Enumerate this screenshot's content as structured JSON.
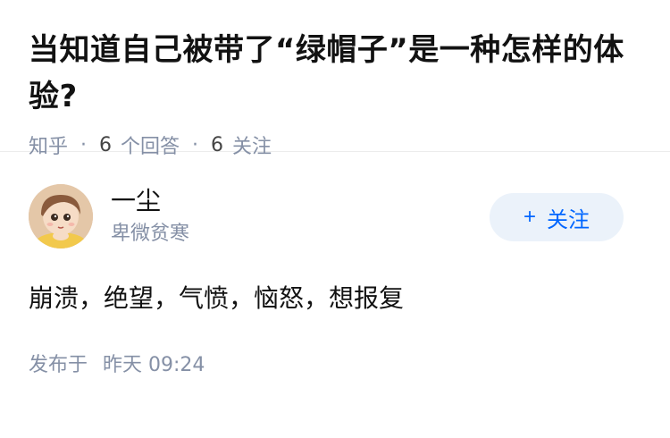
{
  "question": {
    "title": "当知道自己被带了“绿帽子”是一种怎样的体验?",
    "source": "知乎",
    "answer_count": "6",
    "answer_label": "个回答",
    "follower_count": "6",
    "follower_label": "关注"
  },
  "answer": {
    "author_name": "一尘",
    "author_bio": "卑微贫寒",
    "follow_label": "关注",
    "follow_icon": "plus-icon",
    "content": "崩溃，绝望，气愤，恼怒，想报复",
    "published_label": "发布于",
    "published_time": "昨天 09:24"
  },
  "colors": {
    "accent": "#0066ff",
    "follow_bg": "#ebf2fa",
    "muted": "#8590a6"
  }
}
